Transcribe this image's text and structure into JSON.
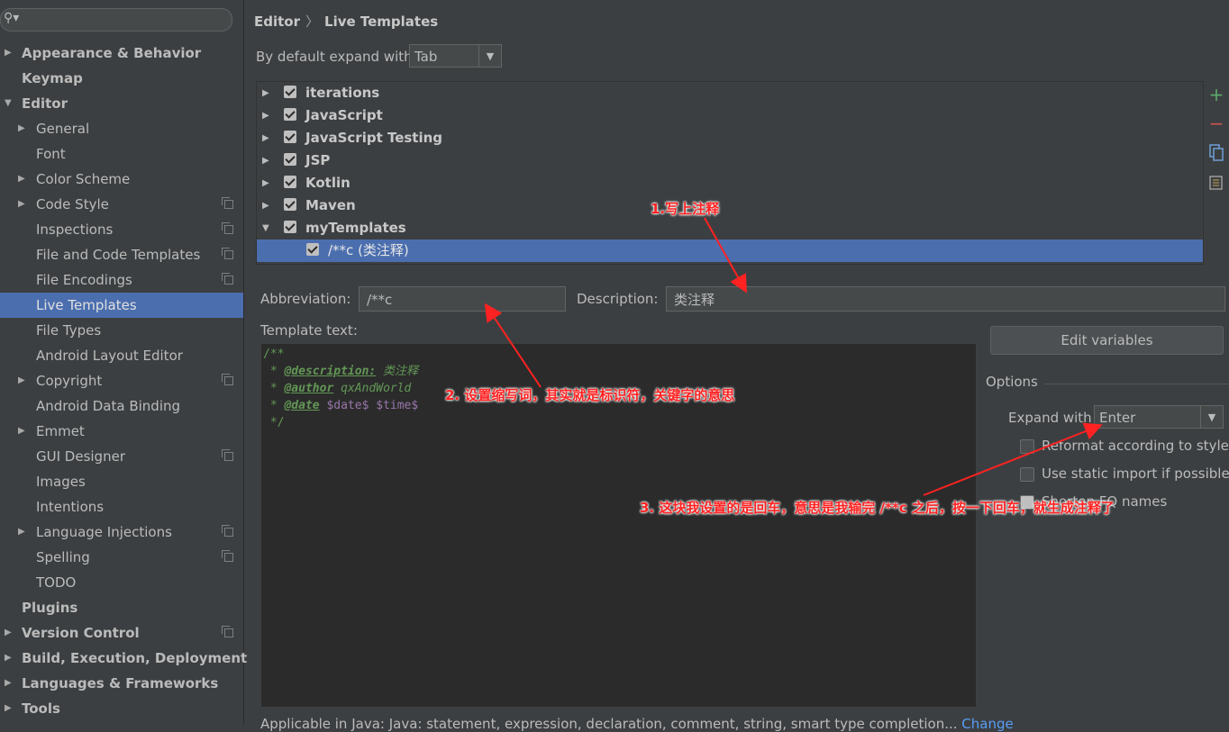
{
  "sidebar": {
    "search_icon": "search-icon",
    "items": [
      {
        "label": "Appearance & Behavior",
        "level": 0,
        "arrow": "▶"
      },
      {
        "label": "Keymap",
        "level": 0,
        "arrow": ""
      },
      {
        "label": "Editor",
        "level": 0,
        "arrow": "▼"
      },
      {
        "label": "General",
        "level": 1,
        "arrow": "▶"
      },
      {
        "label": "Font",
        "level": 1,
        "arrow": ""
      },
      {
        "label": "Color Scheme",
        "level": 1,
        "arrow": "▶"
      },
      {
        "label": "Code Style",
        "level": 1,
        "arrow": "▶",
        "copy": true
      },
      {
        "label": "Inspections",
        "level": 1,
        "arrow": "",
        "copy": true
      },
      {
        "label": "File and Code Templates",
        "level": 1,
        "arrow": "",
        "copy": true
      },
      {
        "label": "File Encodings",
        "level": 1,
        "arrow": "",
        "copy": true
      },
      {
        "label": "Live Templates",
        "level": 1,
        "arrow": "",
        "selected": true
      },
      {
        "label": "File Types",
        "level": 1,
        "arrow": ""
      },
      {
        "label": "Android Layout Editor",
        "level": 1,
        "arrow": ""
      },
      {
        "label": "Copyright",
        "level": 1,
        "arrow": "▶",
        "copy": true
      },
      {
        "label": "Android Data Binding",
        "level": 1,
        "arrow": ""
      },
      {
        "label": "Emmet",
        "level": 1,
        "arrow": "▶"
      },
      {
        "label": "GUI Designer",
        "level": 1,
        "arrow": "",
        "copy": true
      },
      {
        "label": "Images",
        "level": 1,
        "arrow": ""
      },
      {
        "label": "Intentions",
        "level": 1,
        "arrow": ""
      },
      {
        "label": "Language Injections",
        "level": 1,
        "arrow": "▶",
        "copy": true
      },
      {
        "label": "Spelling",
        "level": 1,
        "arrow": "",
        "copy": true
      },
      {
        "label": "TODO",
        "level": 1,
        "arrow": ""
      },
      {
        "label": "Plugins",
        "level": 0,
        "arrow": ""
      },
      {
        "label": "Version Control",
        "level": 0,
        "arrow": "▶",
        "copy": true
      },
      {
        "label": "Build, Execution, Deployment",
        "level": 0,
        "arrow": "▶"
      },
      {
        "label": "Languages & Frameworks",
        "level": 0,
        "arrow": "▶"
      },
      {
        "label": "Tools",
        "level": 0,
        "arrow": "▶"
      }
    ]
  },
  "breadcrumb": {
    "parent": "Editor",
    "separator": "〉",
    "current": "Live Templates"
  },
  "expand_default": {
    "label": "By default expand with",
    "value": "Tab"
  },
  "tree": {
    "rows": [
      {
        "label": "iterations",
        "arrow": "▶",
        "checked": true
      },
      {
        "label": "JavaScript",
        "arrow": "▶",
        "checked": true
      },
      {
        "label": "JavaScript Testing",
        "arrow": "▶",
        "checked": true
      },
      {
        "label": "JSP",
        "arrow": "▶",
        "checked": true
      },
      {
        "label": "Kotlin",
        "arrow": "▶",
        "checked": true
      },
      {
        "label": "Maven",
        "arrow": "▶",
        "checked": true
      },
      {
        "label": "myTemplates",
        "arrow": "▼",
        "checked": true
      },
      {
        "label": "/**c (类注释)",
        "arrow": "",
        "checked": true,
        "child": true,
        "selected": true
      }
    ],
    "tools": {
      "add": "+",
      "remove": "−",
      "copy_icon": "copy-icon",
      "edit_icon": "edit-icon"
    }
  },
  "abbreviation": {
    "label": "Abbreviation:",
    "value": "/**c"
  },
  "description": {
    "label": "Description:",
    "value": "类注释"
  },
  "template_text": {
    "label": "Template text:",
    "lines": [
      {
        "a": "/**"
      },
      {
        "a": " * ",
        "tag": "@description:",
        "b": " 类注释"
      },
      {
        "a": " * ",
        "tag": "@author",
        "b": " qxAndWorld"
      },
      {
        "a": " * ",
        "tag": "@date",
        "b": " ",
        "v1": "$date$",
        "c": " ",
        "v2": "$time$"
      },
      {
        "a": " */"
      }
    ]
  },
  "edit_variables": "Edit variables",
  "options": {
    "title": "Options",
    "expand_label": "Expand with",
    "expand_value": "Enter",
    "reformat": "Reformat according to style",
    "static_import": "Use static import if possible",
    "shorten": "Shorten FQ names"
  },
  "applicable": {
    "text": "Applicable in Java: Java: statement, expression, declaration, comment, string, smart type completion...",
    "link": "Change"
  },
  "annotations": {
    "a1": "1.写上注释",
    "a2": "2. 设置缩写词，其实就是标识符，关键字的意思",
    "a3": "3. 这块我设置的是回车，意思是我输完 /**c 之后，按一下回车，就生成注释了"
  },
  "colors": {
    "accent": "#4b6eaf",
    "annotation": "#ff2222",
    "bg": "#3c3f41",
    "editor_bg": "#2b2b2b"
  }
}
